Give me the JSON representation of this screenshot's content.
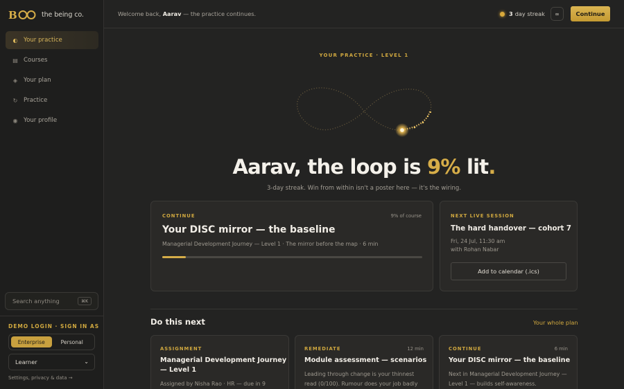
{
  "brand": {
    "name": "the being co."
  },
  "colors": {
    "accent": "#d6ad48",
    "background": "#232322",
    "sidebar": "#1e1e1d",
    "card": "#2a2927"
  },
  "sidebar": {
    "items": [
      {
        "label": "Your practice",
        "icon": "half-circle-icon",
        "active": true
      },
      {
        "label": "Courses",
        "icon": "book-icon",
        "active": false
      },
      {
        "label": "Your plan",
        "icon": "diamond-icon",
        "active": false
      },
      {
        "label": "Practice",
        "icon": "cycle-icon",
        "active": false
      },
      {
        "label": "Your profile",
        "icon": "profile-circle-icon",
        "active": false
      }
    ],
    "search": {
      "placeholder": "Search anything",
      "shortcut": "⌘K"
    },
    "demo_login": {
      "label": "DEMO LOGIN · SIGN IN AS",
      "options": [
        "Enterprise",
        "Personal"
      ],
      "selected": "Enterprise",
      "role": "Learner"
    },
    "settings_link": "Settings, privacy & data →"
  },
  "topbar": {
    "welcome_prefix": "Welcome back, ",
    "user_name": "Aarav",
    "welcome_suffix": " — the practice continues.",
    "streak_count": "3",
    "streak_label": "day streak",
    "theme_icon": "∞",
    "continue_label": "Continue"
  },
  "hero": {
    "kicker": "YOUR PRACTICE · LEVEL 1",
    "headline_prefix": "Aarav, the loop is ",
    "percent": "9%",
    "headline_suffix": " lit",
    "headline_end": ".",
    "subtitle": "3-day streak. Win from within isn't a poster here — it's the wiring."
  },
  "continue_card": {
    "eyebrow": "CONTINUE",
    "meta": "9% of course",
    "title": "Your DISC mirror — the baseline",
    "subtitle": "Managerial Development Journey — Level 1 · The mirror before the map · 6 min",
    "progress": 0.09
  },
  "live_session": {
    "eyebrow": "NEXT LIVE SESSION",
    "title": "The hard handover — cohort 7",
    "datetime": "Fri, 24 Jul, 11:30 am",
    "host": "with Rohan Nabar",
    "button": "Add to calendar (.ics)"
  },
  "next_section": {
    "title": "Do this next",
    "link": "Your whole plan",
    "cards": [
      {
        "eyebrow": "ASSIGNMENT",
        "meta": "",
        "title_line1": "Managerial Development Journey",
        "title_line2": "— Level 1",
        "desc_line1": "Assigned by Nisha Rao · HR — due in 9",
        "desc_line2": ""
      },
      {
        "eyebrow": "REMEDIATE",
        "meta": "12 min",
        "title_line1": "Module assessment — scenarios",
        "title_line2": "",
        "desc_line1": "Leading through change is your thinnest",
        "desc_line2": "read (0/100). Rumour does your job badly"
      },
      {
        "eyebrow": "CONTINUE",
        "meta": "6 min",
        "title_line1": "Your DISC mirror — the baseline",
        "title_line2": "",
        "desc_line1": "Next in Managerial Development Journey —",
        "desc_line2": "Level 1 — builds self-awareness."
      }
    ]
  }
}
